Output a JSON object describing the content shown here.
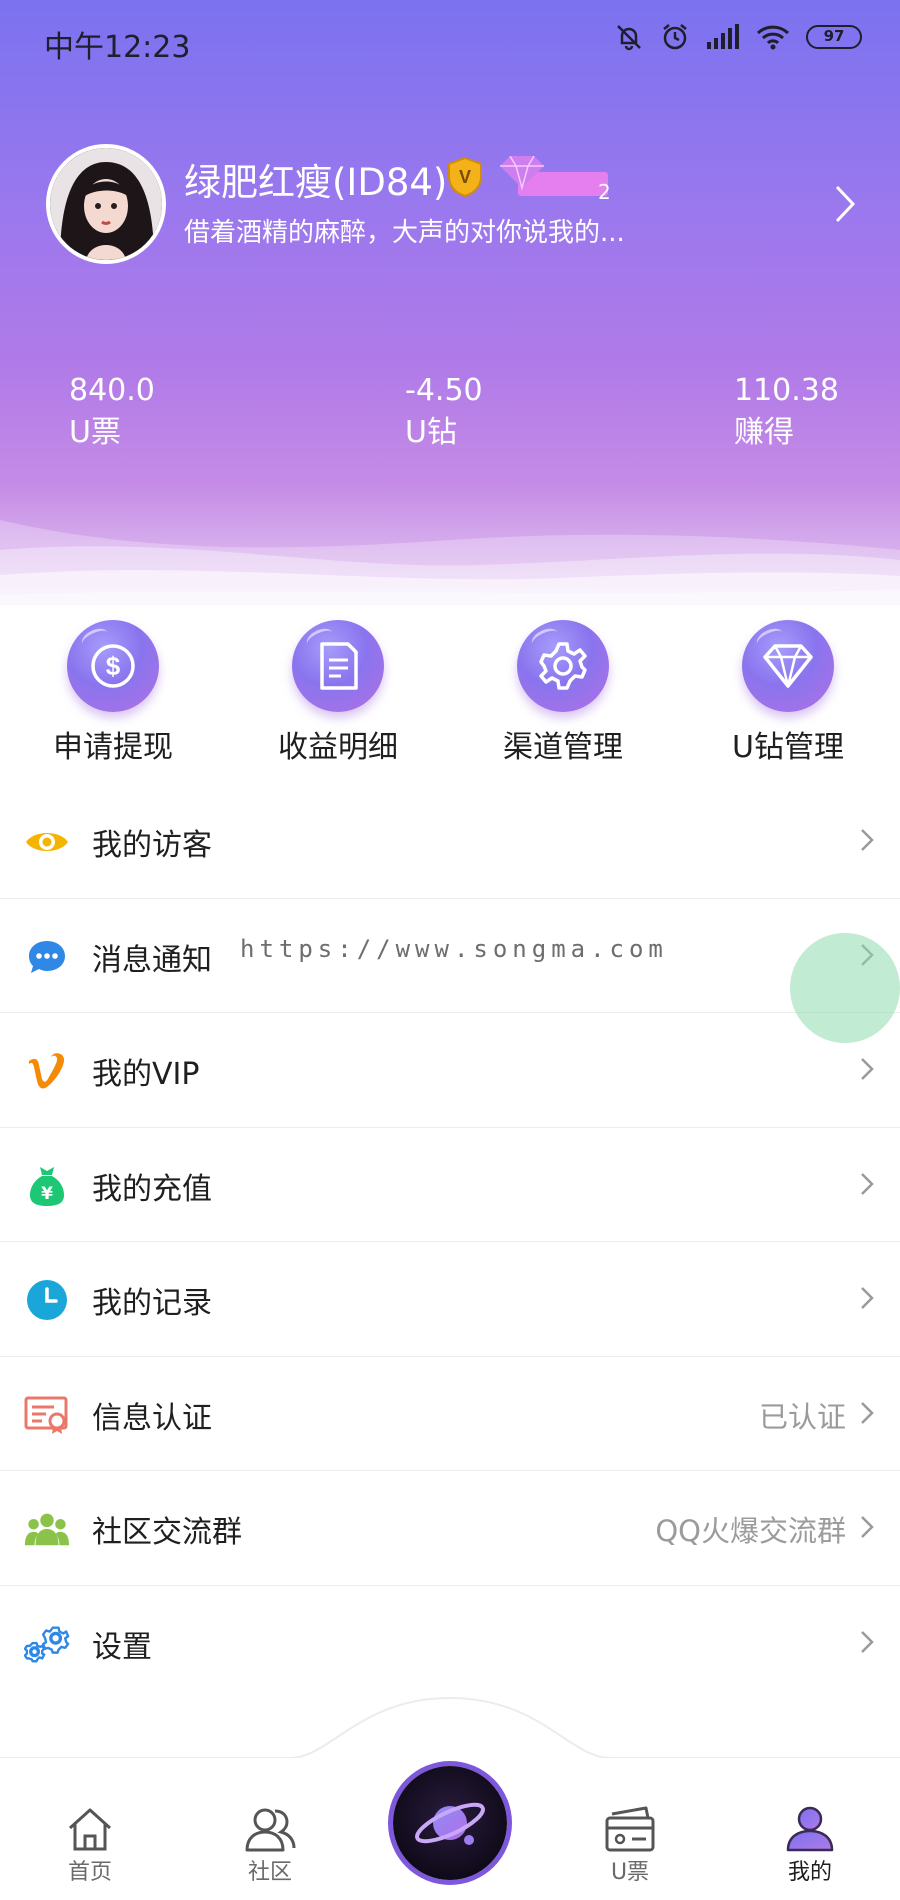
{
  "status_bar": {
    "time": "中午12:23",
    "battery": "97"
  },
  "profile": {
    "nickname": "绿肥红瘦(ID84)",
    "vip_badge_letter": "V",
    "level": "2",
    "signature": "借着酒精的麻醉，大声的对你说我的..."
  },
  "stats": [
    {
      "value": "840.0",
      "label": "U票"
    },
    {
      "value": "-4.50",
      "label": "U钻"
    },
    {
      "value": "110.38",
      "label": "赚得"
    }
  ],
  "quick_actions": [
    {
      "label": "申请提现",
      "icon": "dollar-icon"
    },
    {
      "label": "收益明细",
      "icon": "document-icon"
    },
    {
      "label": "渠道管理",
      "icon": "gear-icon"
    },
    {
      "label": "U钻管理",
      "icon": "diamond-icon"
    }
  ],
  "menu": [
    {
      "label": "我的访客",
      "value": "",
      "icon": "eye-icon",
      "color": "#f5b400"
    },
    {
      "label": "消息通知",
      "value": "",
      "icon": "chat-bubble-icon",
      "color": "#2f88e6"
    },
    {
      "label": "我的VIP",
      "value": "",
      "icon": "vimeo-v-icon",
      "color": "#f58a07"
    },
    {
      "label": "我的充值",
      "value": "",
      "icon": "money-bag-icon",
      "color": "#1ec774"
    },
    {
      "label": "我的记录",
      "value": "",
      "icon": "clock-icon",
      "color": "#1aa6d9"
    },
    {
      "label": "信息认证",
      "value": "已认证",
      "icon": "certificate-icon",
      "color": "#e8796a"
    },
    {
      "label": "社区交流群",
      "value": "QQ火爆交流群",
      "icon": "group-icon",
      "color": "#8bc34a"
    },
    {
      "label": "设置",
      "value": "",
      "icon": "settings-gears-icon",
      "color": "#2f88e6"
    }
  ],
  "watermark": "https://www.songma.com",
  "bottom_nav": [
    {
      "label": "首页",
      "icon": "home-icon"
    },
    {
      "label": "社区",
      "icon": "community-icon"
    },
    {
      "label": "",
      "icon": "planet-icon"
    },
    {
      "label": "U票",
      "icon": "ticket-icon"
    },
    {
      "label": "我的",
      "icon": "profile-icon"
    }
  ],
  "colors": {
    "header_top": "#7b72ef",
    "header_bottom": "#c58be6",
    "accent": "#8a74ee"
  }
}
